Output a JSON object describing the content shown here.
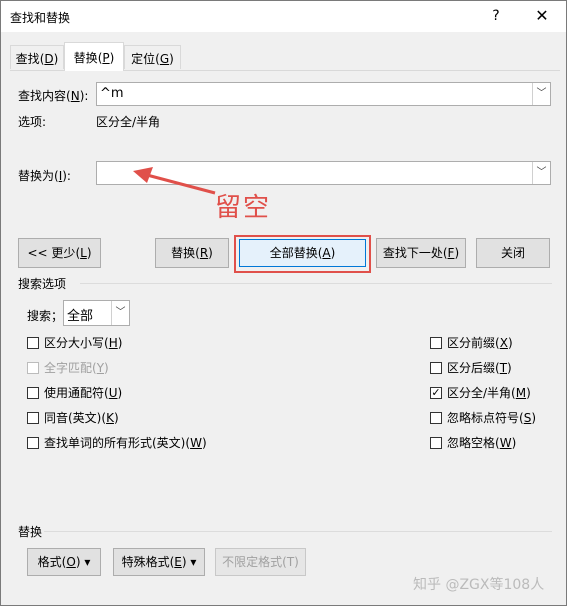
{
  "window": {
    "title": "查找和替换",
    "help": "?",
    "close": "✕"
  },
  "tabs": [
    {
      "label": "查找",
      "key": "D"
    },
    {
      "label": "替换",
      "key": "P"
    },
    {
      "label": "定位",
      "key": "G"
    }
  ],
  "find": {
    "label": "查找内容",
    "key": "N",
    "value": "^m"
  },
  "options": {
    "label": "选项:",
    "value": "区分全/半角"
  },
  "replace": {
    "label": "替换为",
    "key": "I",
    "value": ""
  },
  "annotation": {
    "text": "留空",
    "color": "#e0504a"
  },
  "buttons": {
    "less": {
      "label": "<< 更少",
      "key": "L"
    },
    "replace": {
      "label": "替换",
      "key": "R"
    },
    "replace_all": {
      "label": "全部替换",
      "key": "A"
    },
    "find_next": {
      "label": "查找下一处",
      "key": "F"
    },
    "close": {
      "label": "关闭"
    }
  },
  "search_options": {
    "heading": "搜索选项",
    "search_label": "搜索",
    "search_key": "；",
    "search_value": "全部",
    "left": [
      {
        "label": "区分大小写",
        "key": "H",
        "checked": false,
        "disabled": false
      },
      {
        "label": "全字匹配",
        "key": "Y",
        "checked": false,
        "disabled": true
      },
      {
        "label": "使用通配符",
        "key": "U",
        "checked": false,
        "disabled": false
      },
      {
        "label": "同音(英文)",
        "key": "K",
        "checked": false,
        "disabled": false
      },
      {
        "label": "查找单词的所有形式(英文)",
        "key": "W",
        "checked": false,
        "disabled": false
      }
    ],
    "right": [
      {
        "label": "区分前缀",
        "key": "X",
        "checked": false
      },
      {
        "label": "区分后缀",
        "key": "T",
        "checked": false
      },
      {
        "label": "区分全/半角",
        "key": "M",
        "checked": true
      },
      {
        "label": "忽略标点符号",
        "key": "S",
        "checked": false
      },
      {
        "label": "忽略空格",
        "key": "W",
        "checked": false
      }
    ]
  },
  "replace_section": {
    "heading": "替换",
    "format": {
      "label": "格式",
      "key": "O"
    },
    "special": {
      "label": "特殊格式",
      "key": "E"
    },
    "no_format": {
      "label": "不限定格式(T)"
    }
  },
  "watermark": "知乎 @ZGX等108人"
}
